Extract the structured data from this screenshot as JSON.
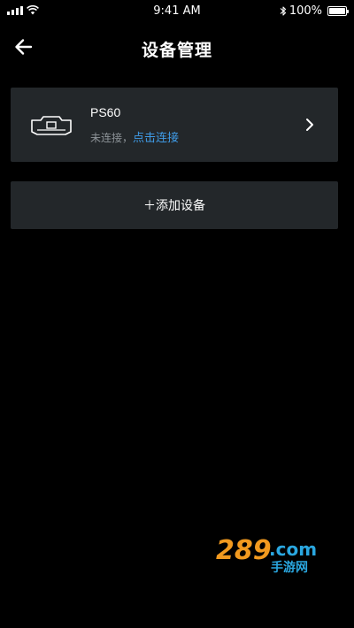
{
  "status_bar": {
    "time": "9:41 AM",
    "battery": "100%",
    "icons": [
      "signal-icon",
      "wifi-icon",
      "bluetooth-icon",
      "battery-icon"
    ]
  },
  "header": {
    "title": "设备管理",
    "back_icon": "back-arrow-icon"
  },
  "devices": [
    {
      "name": "PS60",
      "status": "未连接，",
      "action": "点击连接",
      "icon": "device-icon"
    }
  ],
  "add_device": {
    "label": "＋添加设备"
  },
  "watermark": {
    "text": "289.com 手游网"
  },
  "colors": {
    "background": "#000000",
    "card": "#23272a",
    "link": "#3f9be6",
    "muted_text": "#8e9499",
    "watermark_orange": "#f29a1f",
    "watermark_blue": "#2aa7e0"
  }
}
